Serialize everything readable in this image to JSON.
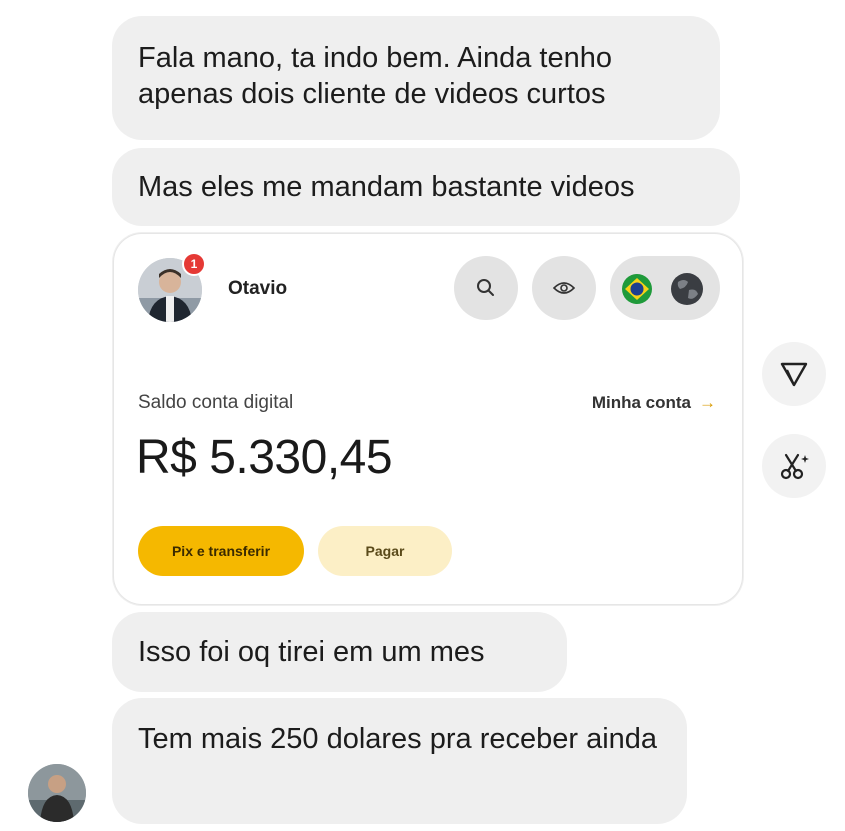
{
  "messages": [
    "Fala mano, ta indo bem. Ainda tenho apenas dois cliente de videos curtos",
    "Mas eles me mandam bastante videos",
    "Isso foi oq tirei em um mes",
    "Tem mais 250 dolares pra receber ainda"
  ],
  "card": {
    "user_name": "Otavio",
    "notification_count": "1",
    "balance_label": "Saldo conta digital",
    "account_link": "Minha conta",
    "account_arrow": "→",
    "balance_value": "R$ 5.330,45",
    "primary_button": "Pix e transferir",
    "secondary_button": "Pagar",
    "accent_color": "#f5b800"
  },
  "icons": {
    "search": "search-icon",
    "visibility": "eye-icon",
    "region": "brazil-flag-icon",
    "globe": "globe-icon",
    "share": "send-icon",
    "remix": "scissors-sparkle-icon"
  }
}
